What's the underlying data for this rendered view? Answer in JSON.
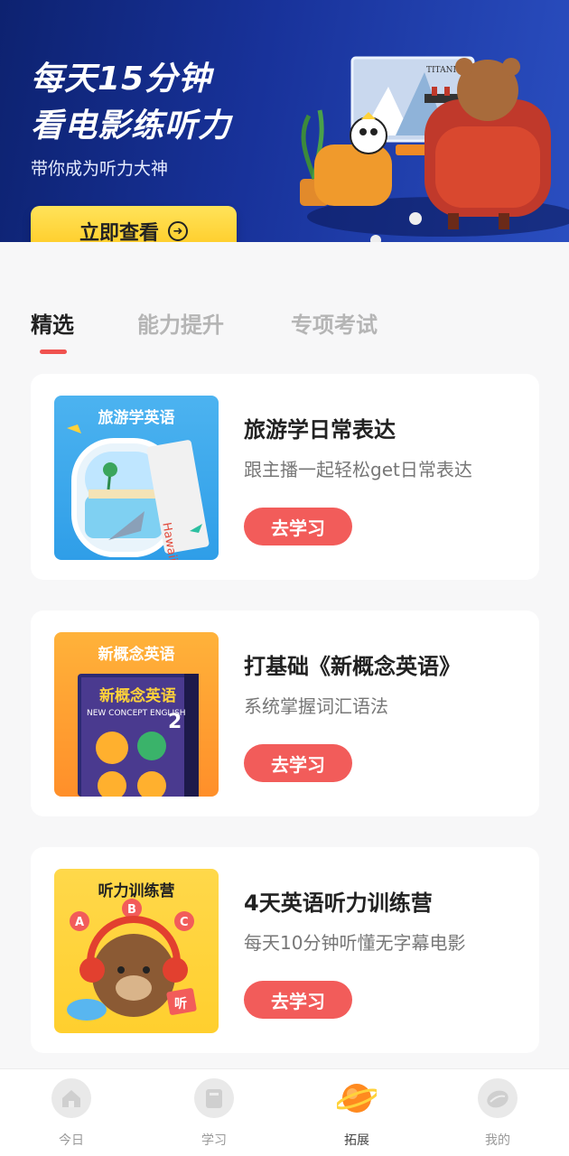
{
  "banner": {
    "title_line1": "每天15分钟",
    "title_line2": "看电影练听力",
    "subtitle": "带你成为听力大神",
    "cta_label": "立即查看",
    "tv_text": "TITANIC"
  },
  "tabs": [
    {
      "label": "精选",
      "active": true
    },
    {
      "label": "能力提升",
      "active": false
    },
    {
      "label": "专项考试",
      "active": false
    }
  ],
  "courses": [
    {
      "tag": "旅游学英语",
      "title": "旅游学日常表达",
      "desc": "跟主播一起轻松get日常表达",
      "button": "去学习",
      "ticket_text": "Hawaii"
    },
    {
      "tag": "新概念英语",
      "title": "打基础《新概念英语》",
      "desc": "系统掌握词汇语法",
      "button": "去学习",
      "book_title": "新概念英语",
      "book_sub": "NEW CONCEPT ENGLISH",
      "book_num": "2"
    },
    {
      "tag": "听力训练营",
      "title": "4天英语听力训练营",
      "desc": "每天10分钟听懂无字幕电影",
      "button": "去学习",
      "letters": [
        "A",
        "B",
        "C"
      ],
      "sign": "听"
    }
  ],
  "nav": [
    {
      "label": "今日",
      "icon": "home-icon",
      "active": false
    },
    {
      "label": "学习",
      "icon": "book-icon",
      "active": false
    },
    {
      "label": "拓展",
      "icon": "planet-icon",
      "active": true
    },
    {
      "label": "我的",
      "icon": "profile-icon",
      "active": false
    }
  ],
  "colors": {
    "accent": "#f25c5a",
    "banner_bg": "#18329a",
    "cta_yellow": "#ffd23a"
  }
}
